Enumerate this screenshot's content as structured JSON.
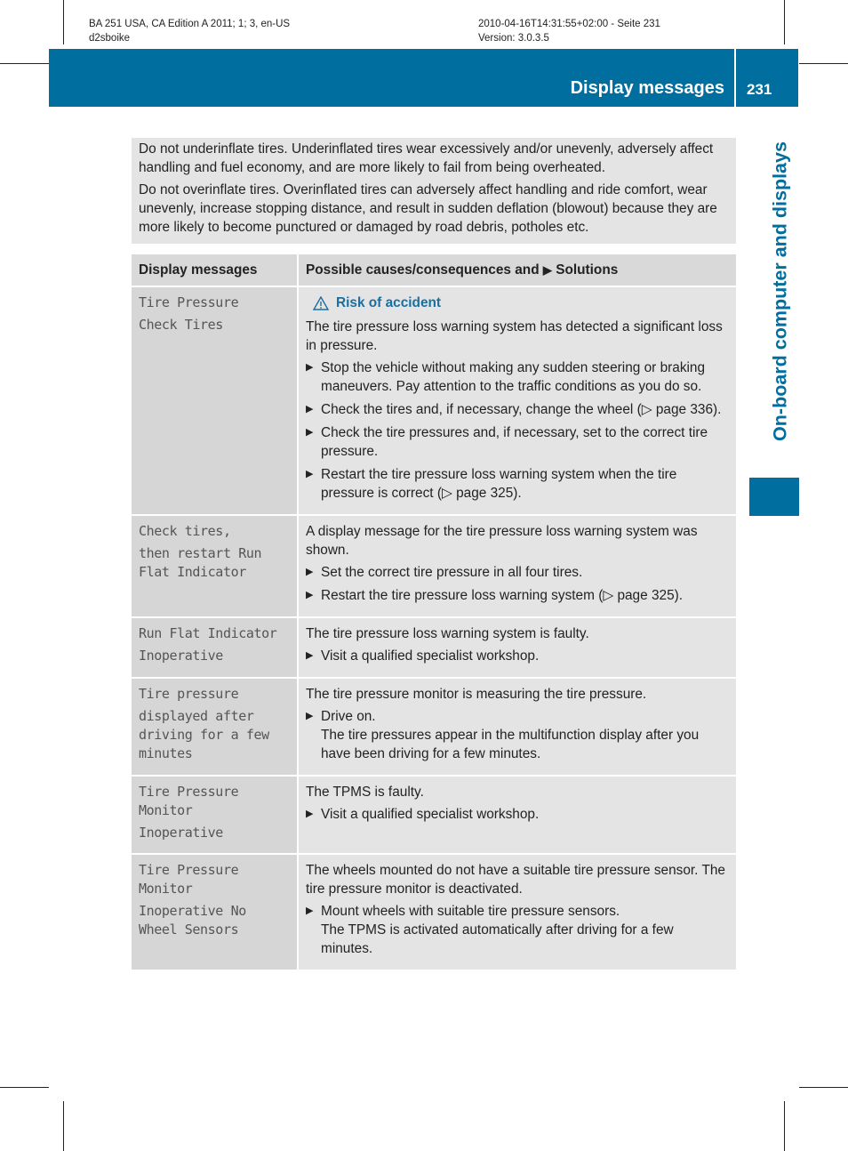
{
  "header_meta": {
    "left_line1": "BA 251 USA, CA Edition A 2011; 1; 3, en-US",
    "left_line2": "d2sboike",
    "right_line1": "2010-04-16T14:31:55+02:00 - Seite 231",
    "right_line2": "Version: 3.0.3.5"
  },
  "banner": {
    "title": "Display messages",
    "page_number": "231",
    "color": "#006e9f"
  },
  "side_tab": {
    "label": "On-board computer and displays"
  },
  "warning_box": {
    "paragraphs": [
      "Do not underinflate tires. Underinflated tires wear excessively and/or unevenly, adversely affect handling and fuel economy, and are more likely to fail from being overheated.",
      "Do not overinflate tires. Overinflated tires can adversely affect handling and ride comfort, wear unevenly, increase stopping distance, and result in sudden deflation (blowout) because they are more likely to become punctured or damaged by road debris, potholes etc."
    ]
  },
  "table": {
    "headers": {
      "col1": "Display messages",
      "col2_pre": "Possible causes/consequences and",
      "col2_icon": "solutions-arrow-icon",
      "col2_post": "Solutions"
    },
    "rows": [
      {
        "message": [
          "Tire Pressure",
          "Check Tires"
        ],
        "risk": "Risk of accident",
        "text": [
          "The tire pressure loss warning system has detected a significant loss in pressure."
        ],
        "steps": [
          "Stop the vehicle without making any sudden steering or braking maneuvers. Pay attention to the traffic conditions as you do so.",
          "Check the tires and, if necessary, change the wheel (▷ page 336).",
          "Check the tire pressures and, if necessary, set to the correct tire pressure.",
          "Restart the tire pressure loss warning system when the tire pressure is correct (▷ page 325)."
        ]
      },
      {
        "message": [
          "Check tires,",
          "then restart Run Flat Indicator"
        ],
        "text": [
          "A display message for the tire pressure loss warning system was shown."
        ],
        "steps": [
          "Set the correct tire pressure in all four tires.",
          "Restart the tire pressure loss warning system (▷ page 325)."
        ]
      },
      {
        "message": [
          "Run Flat Indicator",
          "Inoperative"
        ],
        "text": [
          "The tire pressure loss warning system is faulty."
        ],
        "steps": [
          "Visit a qualified specialist workshop."
        ]
      },
      {
        "message": [
          "Tire pressure",
          "displayed after driving for a few minutes"
        ],
        "text": [
          "The tire pressure monitor is measuring the tire pressure."
        ],
        "steps": [
          "Drive on.",
          "The tire pressures appear in the multifunction display after you have been driving for a few minutes."
        ]
      },
      {
        "message": [
          "Tire Pressure Monitor",
          "Inoperative"
        ],
        "text": [
          "The TPMS is faulty."
        ],
        "steps": [
          "Visit a qualified specialist workshop."
        ]
      },
      {
        "message": [
          "Tire Pressure Monitor",
          "Inoperative No Wheel Sensors"
        ],
        "text": [
          "The wheels mounted do not have a suitable tire pressure sensor. The tire pressure monitor is deactivated."
        ],
        "steps": [
          "Mount wheels with suitable tire pressure sensors.",
          "The TPMS is activated automatically after driving for a few minutes."
        ]
      }
    ]
  }
}
